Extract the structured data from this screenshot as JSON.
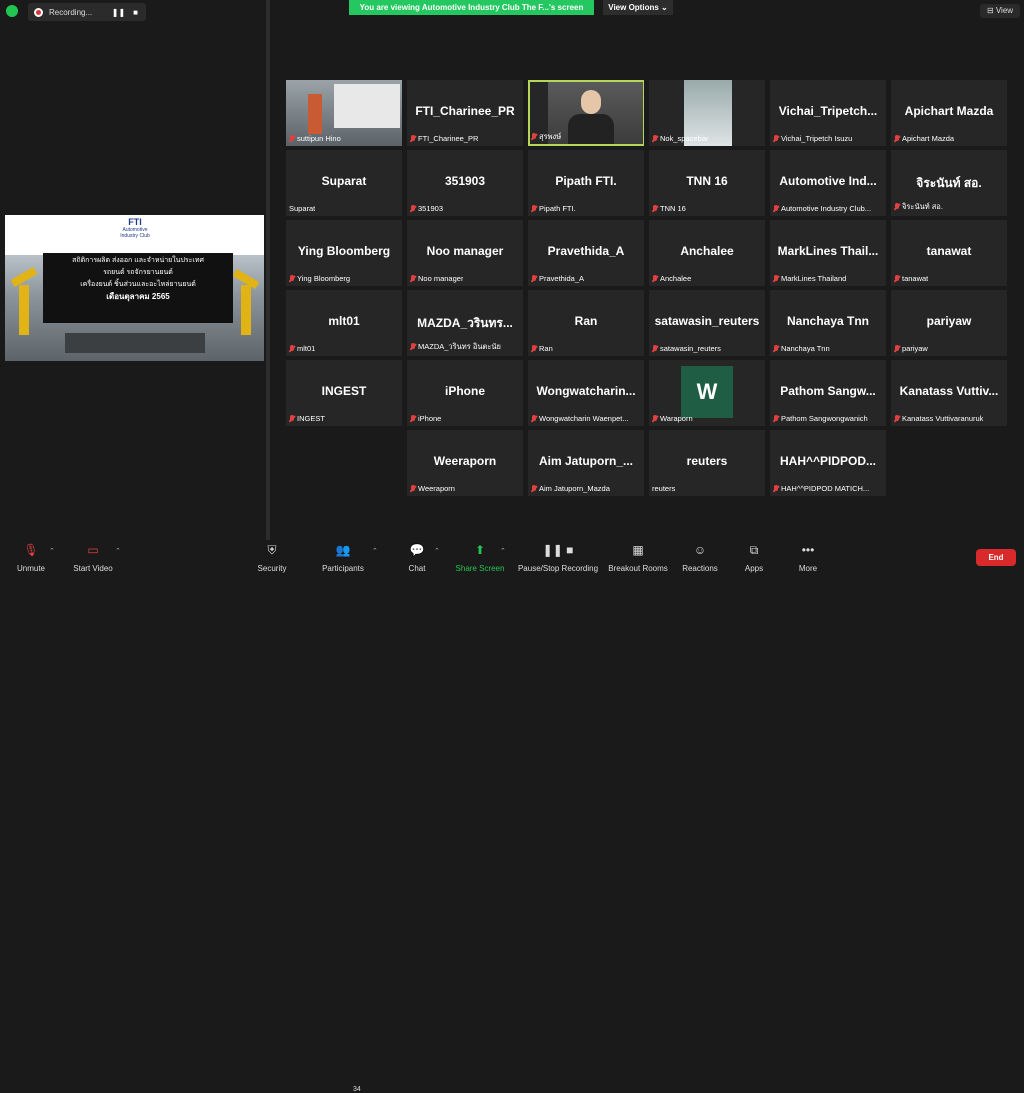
{
  "topbar": {
    "recording_label": "Recording...",
    "pause_glyph": "❚❚",
    "stop_glyph": "■",
    "viewing_banner": "You are viewing Automotive Industry Club The F...'s screen",
    "view_options": "View Options ⌄",
    "view_button": "⊟ View"
  },
  "shared_screen": {
    "logo_text": "FTI",
    "logo_sub": "Automotive Industry Club",
    "line1": "สถิติการผลิต ส่งออก และจำหน่ายในประเทศ",
    "line2": "รถยนต์ รถจักรยานยนต์",
    "line3": "เครื่องยนต์ ชิ้นส่วนและอะไหล่ยานยนต์",
    "line4": "เดือนตุลาคม 2565"
  },
  "participants": [
    {
      "big": "",
      "name": "suttipun Hino",
      "video": "hino"
    },
    {
      "big": "FTI_Charinee_PR",
      "name": "FTI_Charinee_PR"
    },
    {
      "big": "",
      "name": "สุรพงษ์",
      "video": "person",
      "active": true
    },
    {
      "big": "",
      "name": "Nok_spacebar",
      "video": "nok"
    },
    {
      "big": "Vichai_Tripetch...",
      "name": "Vichai_Tripetch Isuzu"
    },
    {
      "big": "Apichart Mazda",
      "name": "Apichart Mazda"
    },
    {
      "big": "Suparat",
      "name": "Suparat",
      "nomic": true
    },
    {
      "big": "351903",
      "name": "351903"
    },
    {
      "big": "Pipath FTI.",
      "name": "Pipath FTI."
    },
    {
      "big": "TNN 16",
      "name": "TNN 16"
    },
    {
      "big": "Automotive Ind...",
      "name": "Automotive Industry Club..."
    },
    {
      "big": "จิระนันท์ สอ.",
      "name": "จิระนันท์ สอ."
    },
    {
      "big": "Ying Bloomberg",
      "name": "Ying Bloomberg"
    },
    {
      "big": "Noo manager",
      "name": "Noo manager"
    },
    {
      "big": "Pravethida_A",
      "name": "Pravethida_A"
    },
    {
      "big": "Anchalee",
      "name": "Anchalee"
    },
    {
      "big": "MarkLines Thail...",
      "name": "MarkLines Thailand"
    },
    {
      "big": "tanawat",
      "name": "tanawat"
    },
    {
      "big": "mlt01",
      "name": "mlt01"
    },
    {
      "big": "MAZDA_วรินทร...",
      "name": "MAZDA_วรินทร อินตะนัย"
    },
    {
      "big": "Ran",
      "name": "Ran"
    },
    {
      "big": "satawasin_reuters",
      "name": "satawasin_reuters"
    },
    {
      "big": "Nanchaya Tnn",
      "name": "Nanchaya Tnn"
    },
    {
      "big": "pariyaw",
      "name": "pariyaw"
    },
    {
      "big": "INGEST",
      "name": "INGEST"
    },
    {
      "big": "iPhone",
      "name": "iPhone"
    },
    {
      "big": "Wongwatcharin...",
      "name": "Wongwatcharin Waenpet..."
    },
    {
      "big": "",
      "name": "Waraporn",
      "video": "w"
    },
    {
      "big": "Pathom Sangw...",
      "name": "Pathom Sangwongwanich"
    },
    {
      "big": "Kanatass Vuttiv...",
      "name": "Kanatass Vuttivaranuruk"
    },
    {
      "big": "Weeraporn",
      "name": "Weeraporn"
    },
    {
      "big": "Aim Jatuporn_...",
      "name": "Aim Jatuporn_Mazda"
    },
    {
      "big": "reuters",
      "name": "reuters",
      "nomic": true
    },
    {
      "big": "HAH^^PIDPOD...",
      "name": "HAH^^PIDPOD MATICH..."
    }
  ],
  "w_letter": "W",
  "toolbar": {
    "unmute": "Unmute",
    "start_video": "Start Video",
    "security": "Security",
    "participants": "Participants",
    "participants_count": "34",
    "chat": "Chat",
    "share_screen": "Share Screen",
    "pause_recording": "Pause/Stop Recording",
    "breakout": "Breakout Rooms",
    "reactions": "Reactions",
    "apps": "Apps",
    "more": "More",
    "end": "End"
  }
}
